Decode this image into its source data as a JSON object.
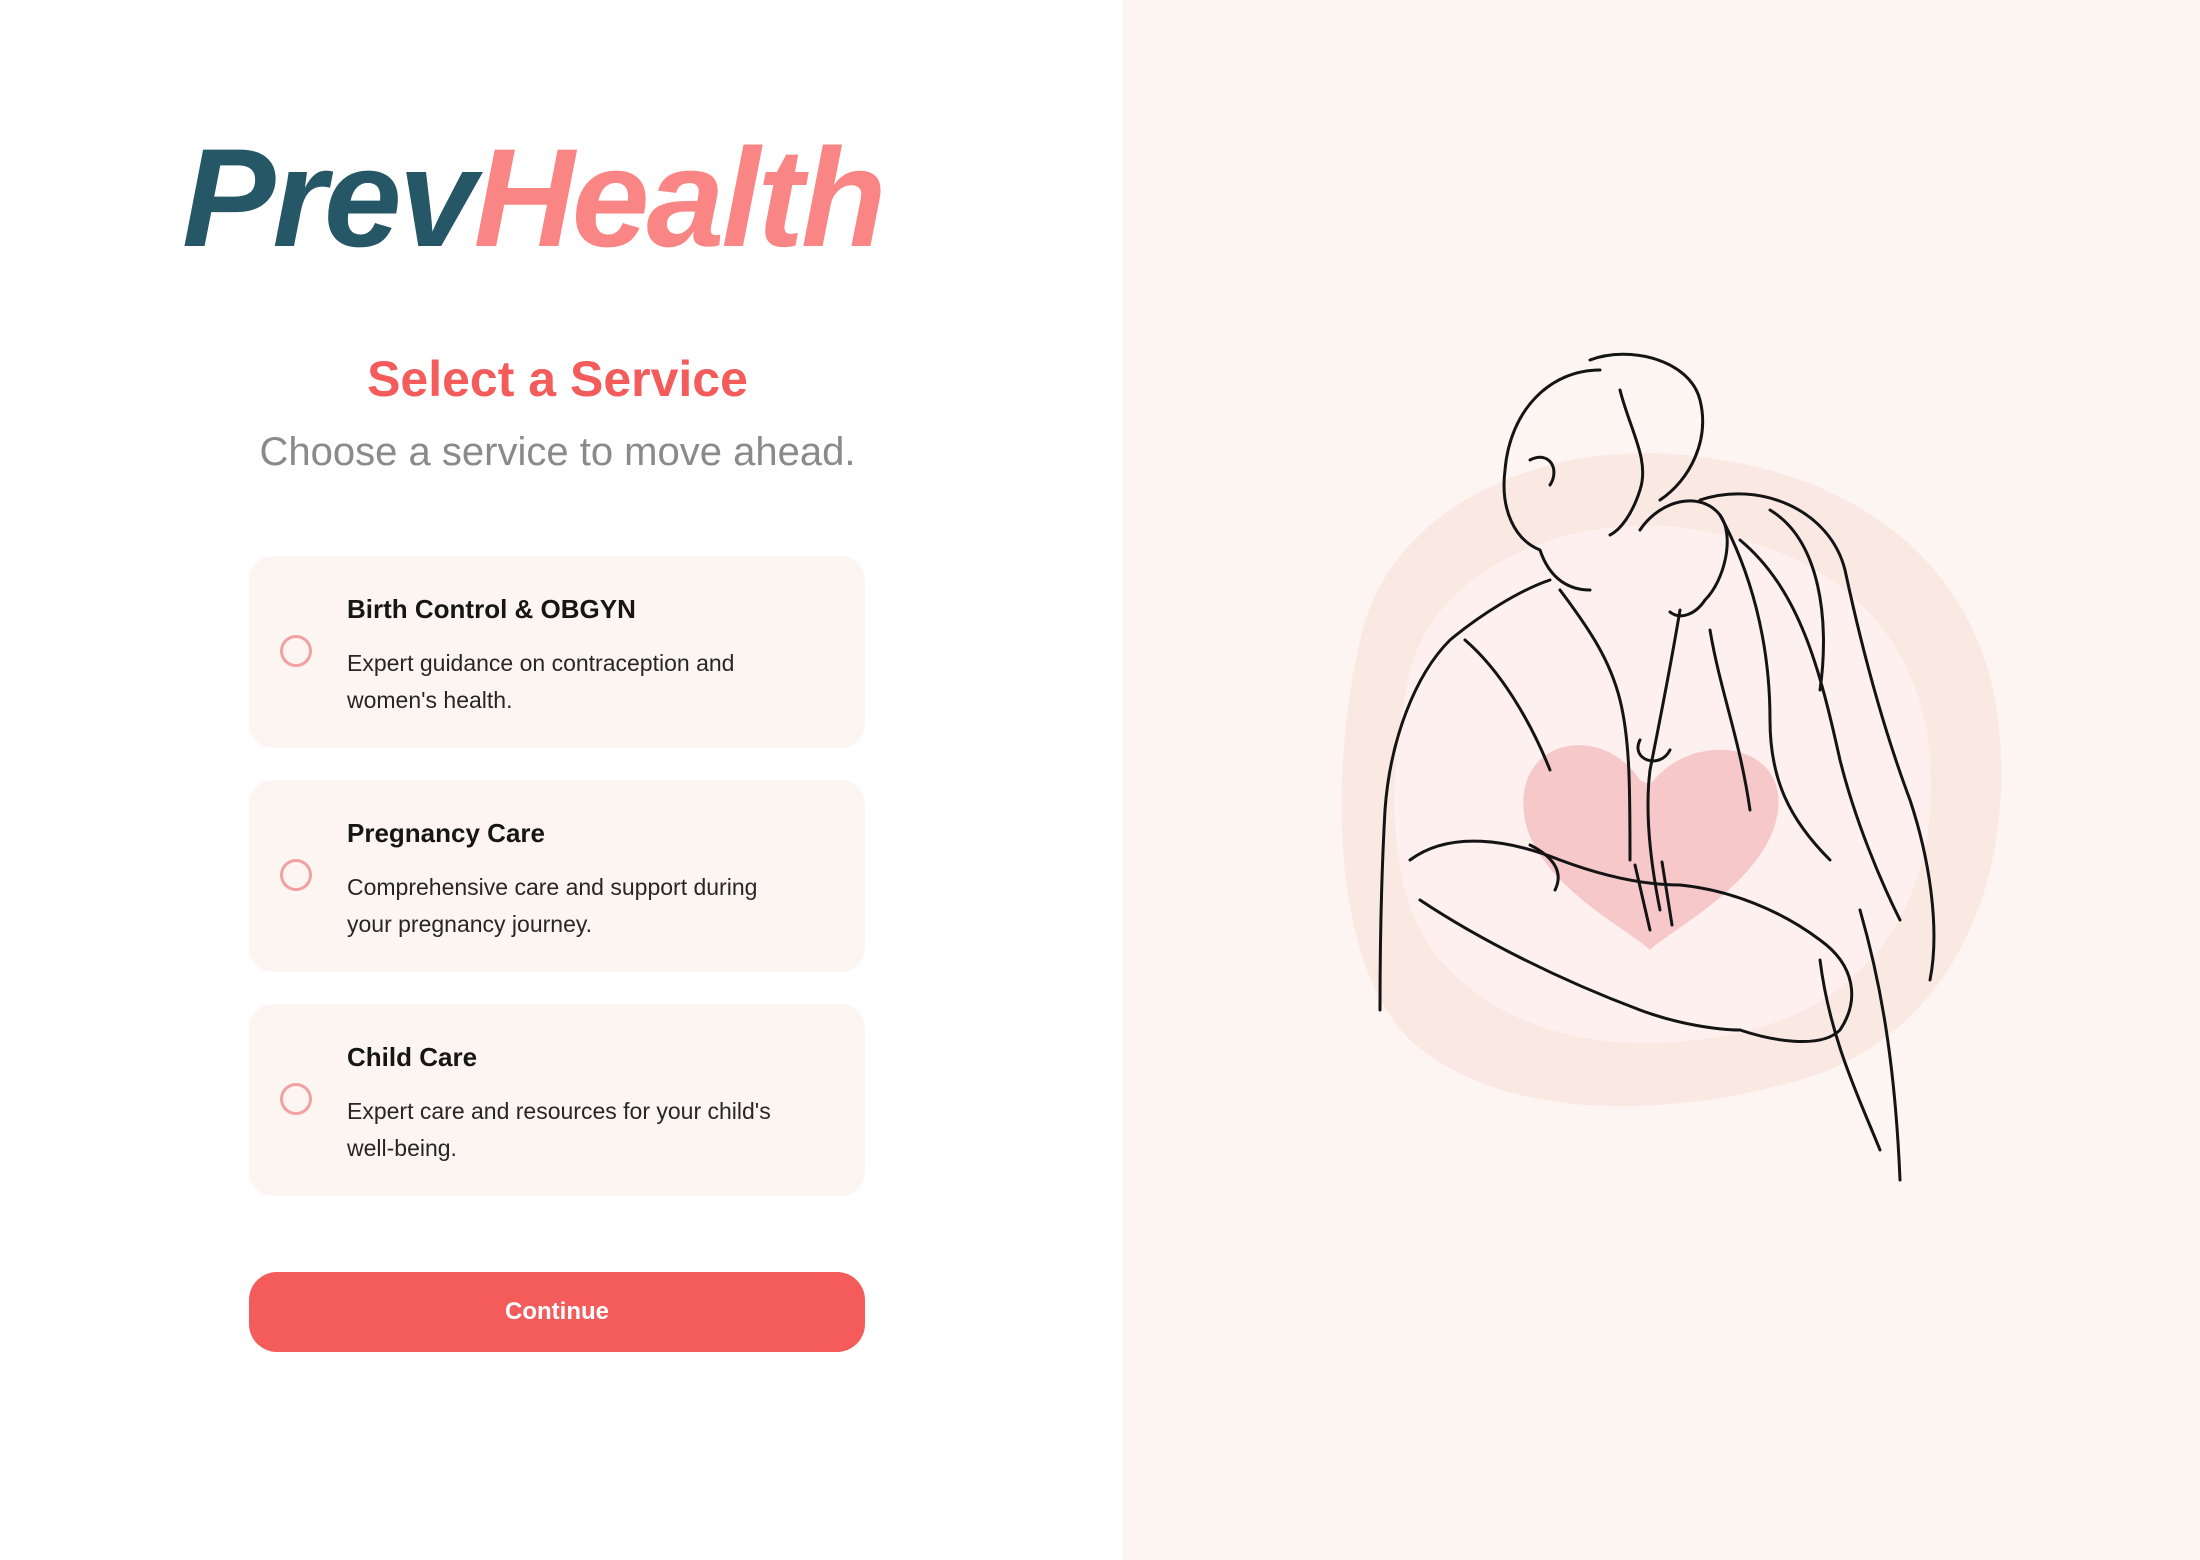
{
  "brand": {
    "part1": "Prev",
    "part2": "Health"
  },
  "header": {
    "title": "Select a Service",
    "subtitle": "Choose a service to move ahead."
  },
  "services": [
    {
      "title": "Birth Control & OBGYN",
      "line1": "Expert guidance on contraception and",
      "line2": "women's health."
    },
    {
      "title": "Pregnancy Care",
      "line1": "Comprehensive care and support during",
      "line2": "your pregnancy journey."
    },
    {
      "title": "Child Care",
      "line1": "Expert care and resources for your child's",
      "line2": "well-being."
    }
  ],
  "actions": {
    "continue_label": "Continue"
  },
  "colors": {
    "brand_dark": "#255767",
    "brand_accent": "#fa8585",
    "primary": "#f45c5c",
    "panel_bg": "#fdf5f2"
  },
  "illustration": {
    "icon": "couple-line-art-icon"
  }
}
